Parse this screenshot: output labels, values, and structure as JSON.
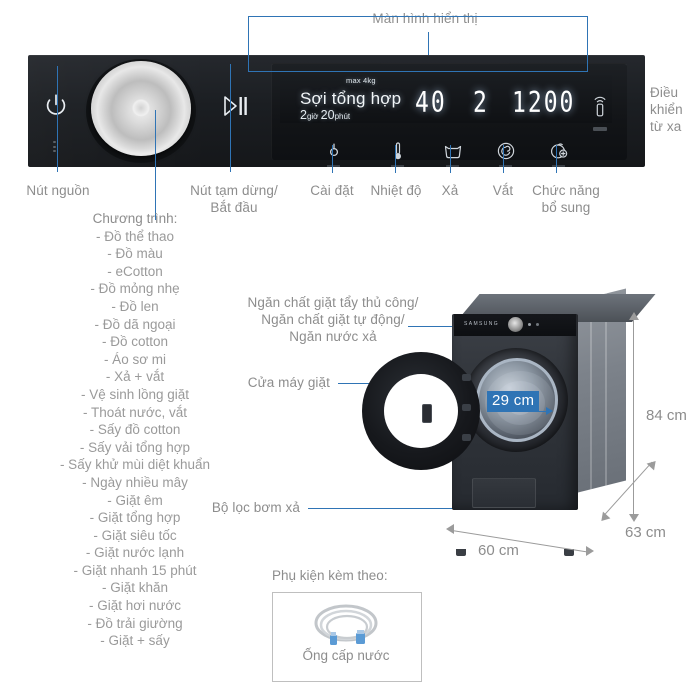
{
  "page": {
    "title": "Sơ đồ máy giặt sấy — chú thích bảng điều khiển và kích thước",
    "accent_blue": "#2f74b5",
    "text_gray": "#8d8d8d"
  },
  "annotations": {
    "display": "Màn hình hiển thị",
    "remote": "Điều\nkhiển\ntừ xa",
    "power_button": "Nút nguồn",
    "program_label": "Chương trình:",
    "pause_start": "Nút tạm dừng/\nBắt đầu",
    "settings": "Cài đặt",
    "temperature": "Nhiệt độ",
    "rinse": "Xả",
    "spin": "Vắt",
    "extra_function": "Chức năng\nbổ sung",
    "detergent_drawer": "Ngăn chất giặt tẩy thủ công/\nNgăn chất giặt tự động/\nNgăn nước xả",
    "door": "Cửa máy giặt",
    "pump_filter": "Bộ lọc bơm xả"
  },
  "display": {
    "program_name": "Sợi tổng hợp",
    "max_load": "max 4kg",
    "time_hours_value": "2",
    "time_hours_unit": "giờ",
    "time_minutes_value": "20",
    "time_minutes_unit": "phút",
    "temperature_value": "40",
    "rinse_value": "2",
    "spin_value": "1200"
  },
  "control_icons": [
    {
      "name": "power-icon",
      "label": "Nút nguồn"
    },
    {
      "name": "program-dial",
      "label": "Chương trình:"
    },
    {
      "name": "play-pause-icon",
      "label": "Nút tạm dừng/Bắt đầu"
    },
    {
      "name": "settings-icon",
      "label": "Cài đặt"
    },
    {
      "name": "thermometer-icon",
      "label": "Nhiệt độ"
    },
    {
      "name": "rinse-tub-icon",
      "label": "Xả"
    },
    {
      "name": "spin-spiral-icon",
      "label": "Vắt"
    },
    {
      "name": "extra-function-icon",
      "label": "Chức năng bổ sung"
    },
    {
      "name": "remote-wifi-icon",
      "label": "Điều khiển từ xa"
    }
  ],
  "programs": {
    "heading": "Chương trình:",
    "items": [
      "- Đồ thể thao",
      "- Đồ màu",
      "- eCotton",
      "- Đồ mỏng nhẹ",
      "- Đồ len",
      "- Đồ dã ngoại",
      "- Đồ cotton",
      "- Áo sơ mi",
      "- Xả + vắt",
      "- Vệ sinh lồng giặt",
      "- Thoát nước, vắt",
      "- Sấy đồ cotton",
      "- Sấy vải tổng hợp",
      "- Sấy khử mùi diệt khuẩn",
      "- Ngày nhiều mây",
      "- Giặt êm",
      "- Giặt tổng hợp",
      "- Giặt siêu tốc",
      "- Giặt nước lạnh",
      "- Giặt nhanh 15 phút",
      "- Giặt khăn",
      "- Giặt hơi nước",
      "- Đồ trải giường",
      "- Giặt + sấy"
    ]
  },
  "dimensions": {
    "drum_opening": "29 cm",
    "height": "84 cm",
    "width": "60 cm",
    "depth": "63 cm"
  },
  "accessories": {
    "heading": "Phụ kiện kèm theo:",
    "items": [
      {
        "name": "water-inlet-hose",
        "caption": "Ống cấp nước"
      }
    ]
  },
  "machine": {
    "brand": "SAMSUNG"
  }
}
